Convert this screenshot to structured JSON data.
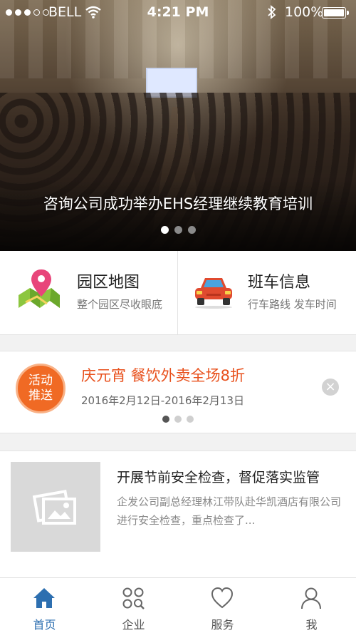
{
  "status_bar": {
    "carrier": "BELL",
    "time": "4:21 PM",
    "battery": "100%"
  },
  "banner": {
    "caption": "咨询公司成功举办EHS经理继续教育培训",
    "dots": 3,
    "active_dot": 0
  },
  "quick_links": [
    {
      "title": "园区地图",
      "subtitle": "整个园区尽收眼底",
      "icon": "map-pin-icon"
    },
    {
      "title": "班车信息",
      "subtitle": "行车路线 发车时间",
      "icon": "car-icon"
    }
  ],
  "promo": {
    "badge_line1": "活动",
    "badge_line2": "推送",
    "title": "庆元宵 餐饮外卖全场8折",
    "date": "2016年2月12日-2016年2月13日",
    "close": "×",
    "colors": {
      "accent": "#e8501c",
      "badge": "#f06a24"
    }
  },
  "news": {
    "title": "开展节前安全检查，督促落实监管",
    "summary": "企发公司副总经理林江带队赴华凯酒店有限公司进行安全检查，重点检查了..."
  },
  "tabs": [
    {
      "label": "首页",
      "icon": "home-icon",
      "active": true
    },
    {
      "label": "企业",
      "icon": "grid-search-icon",
      "active": false
    },
    {
      "label": "服务",
      "icon": "heart-icon",
      "active": false
    },
    {
      "label": "我",
      "icon": "user-icon",
      "active": false
    }
  ],
  "colors": {
    "tab_active": "#2d6fb0"
  }
}
